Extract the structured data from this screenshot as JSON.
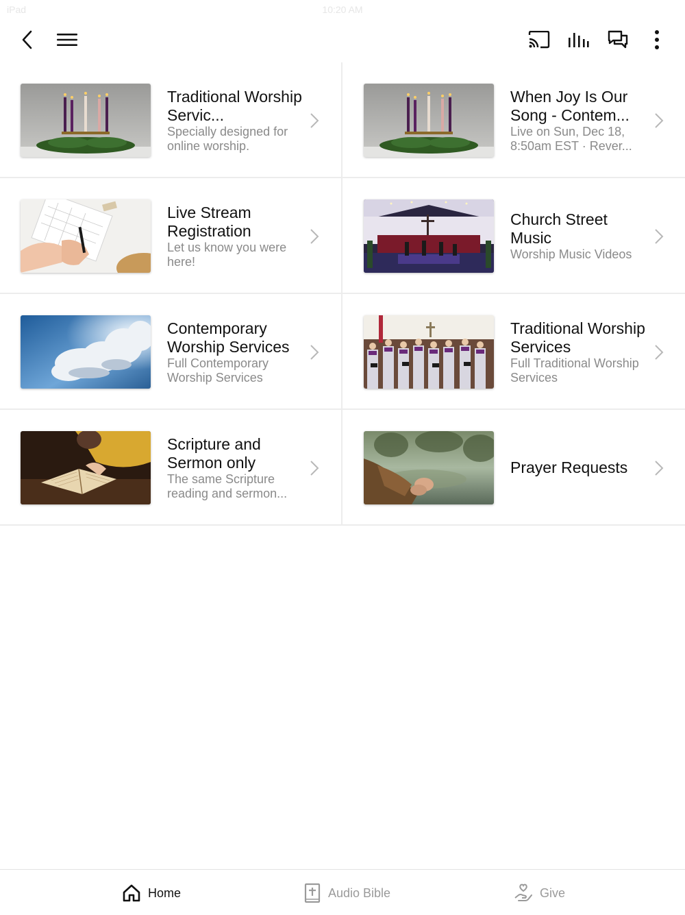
{
  "statusbar": {
    "carrier": "iPad",
    "time": "10:20 AM"
  },
  "topbar": {
    "icons": [
      "back-icon",
      "menu-icon",
      "cast-icon",
      "audio-bars-icon",
      "chat-icon",
      "more-vertical-icon"
    ]
  },
  "tiles": [
    {
      "title": "Traditional Worship Servic...",
      "subtitle": "Specially designed for online worship.",
      "image": "advent-candles"
    },
    {
      "title": "When Joy Is Our Song - Contem...",
      "subtitle": "Live on Sun, Dec 18, 8:50am EST · Rever...",
      "image": "advent-candles"
    },
    {
      "title": "Live Stream Registration",
      "subtitle": "Let us know you were here!",
      "image": "hands-calendar"
    },
    {
      "title": "Church Street Music",
      "subtitle": "Worship Music Videos",
      "image": "church-stage"
    },
    {
      "title": "Contemporary Worship Services",
      "subtitle": "Full Contemporary Worship Services",
      "image": "sky-clouds"
    },
    {
      "title": "Traditional Worship Services",
      "subtitle": "Full Traditional Worship Services",
      "image": "choir"
    },
    {
      "title": "Scripture and Sermon only",
      "subtitle": "The same Scripture reading and sermon...",
      "image": "open-bible"
    },
    {
      "title": "Prayer Requests",
      "subtitle": "",
      "image": "praying-hands"
    }
  ],
  "tabbar": {
    "home": "Home",
    "audio_bible": "Audio Bible",
    "give": "Give"
  },
  "colors": {
    "text": "#111111",
    "subtle": "#8a8a8a",
    "divider": "#ececec",
    "inactive_tab": "#9a9a9a"
  }
}
